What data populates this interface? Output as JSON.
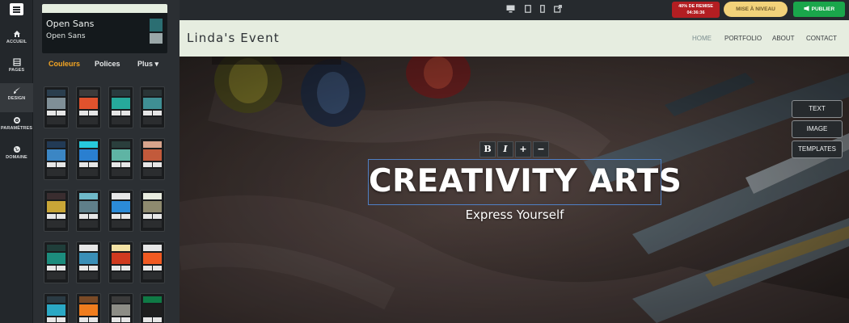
{
  "rail": {
    "items": [
      {
        "label": "ACCUEIL",
        "icon": "home-icon"
      },
      {
        "label": "PAGES",
        "icon": "pages-icon"
      },
      {
        "label": "DESIGN",
        "icon": "brush-icon"
      },
      {
        "label": "PARAMÈTRES",
        "icon": "gear-icon"
      },
      {
        "label": "DOMAINE",
        "icon": "globe-icon"
      }
    ]
  },
  "panel": {
    "font_primary": "Open Sans",
    "font_secondary": "Open Sans",
    "tabs": [
      "Couleurs",
      "Polices",
      "Plus ▾"
    ],
    "active_tab": "Couleurs",
    "palettes": [
      [
        "#2a3e4e",
        "#7f8f97"
      ],
      [
        "#3b3b3b",
        "#e0522d"
      ],
      [
        "#2a3a3e",
        "#26a99b"
      ],
      [
        "#2a3436",
        "#3f8f94"
      ],
      [
        "#223a55",
        "#3b86c4"
      ],
      [
        "#27c9dc",
        "#2a7fd0"
      ],
      [
        "#2a3e3c",
        "#5fb4a4"
      ],
      [
        "#d7a48c",
        "#c25a3b"
      ],
      [
        "#3a2d2f",
        "#c9a637"
      ],
      [
        "#6fb9c8",
        "#5f7f8a"
      ],
      [
        "#e6e6e6",
        "#2b8bd8"
      ],
      [
        "#e9ecdf",
        "#8e8a6f"
      ],
      [
        "#1f3e3a",
        "#1c8c7d"
      ],
      [
        "#e6e6e6",
        "#3a8fb7"
      ],
      [
        "#f3e2a4",
        "#d03a1f"
      ],
      [
        "#e6e6e6",
        "#f05a22"
      ],
      [
        "#2a3b44",
        "#2aa8c4"
      ],
      [
        "#7a4a26",
        "#f07d1e"
      ],
      [
        "#3b3b3b",
        "#8d8d86"
      ],
      [
        "#0f7a45",
        "#1e1e1e"
      ]
    ]
  },
  "topbar": {
    "devices": [
      "desktop-icon",
      "tablet-icon",
      "mobile-icon",
      "external-link-icon"
    ],
    "promo_line1": "40% DE REMISE",
    "promo_timer": "04:36:36",
    "upgrade_label": "MISE À NIVEAU",
    "publish_label": "PUBLIER"
  },
  "site": {
    "brand": "Linda's Event",
    "nav": [
      "HOME",
      "PORTFOLIO",
      "ABOUT",
      "CONTACT"
    ],
    "active_nav": "HOME",
    "headline": "CREATIVITY ARTS",
    "subline": "Express Yourself",
    "format_tools": [
      "B",
      "I",
      "+",
      "−"
    ],
    "side_buttons": [
      "TEXT",
      "IMAGE",
      "TEMPLATES"
    ]
  },
  "colors": {
    "accent_tab": "#f5a623",
    "publish": "#1aa64b",
    "promo": "#b31e22",
    "upgrade": "#f2d27a",
    "header_bg": "#e6ede0"
  }
}
